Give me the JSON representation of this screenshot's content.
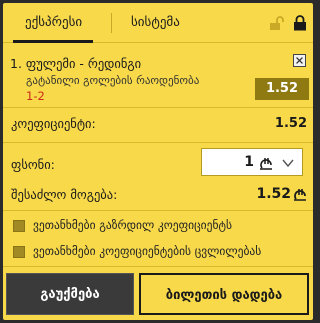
{
  "tabs": [
    {
      "label": "ექსპრესი",
      "active": true
    },
    {
      "label": "სისტემა",
      "active": false
    }
  ],
  "icons": {
    "unlock": "lock-open-icon",
    "lock": "lock-icon",
    "remove": "close-icon",
    "currency": "lari-icon",
    "dropdown": "chevron-down-icon"
  },
  "bet": {
    "index": "1.",
    "match": "ფულემი - რედინგი",
    "market": "გატანილი გოლების რაოდენობა",
    "pick": "1-2",
    "odds": "1.52"
  },
  "summary": {
    "coef_label": "კოეფიციენტი:",
    "coef_value": "1.52",
    "stake_label": "ფსონი:",
    "stake_value": "1",
    "win_label": "შესაძლო მოგება:",
    "win_value": "1.52"
  },
  "options": [
    {
      "label": "ვეთანხმები გაზრდილ კოეფიციენტს",
      "checked": false
    },
    {
      "label": "ვეთანხმები კოეფიციენტების ცვლილებას",
      "checked": false
    }
  ],
  "buttons": {
    "cancel": "გაუქმება",
    "place": "ბილეთის დადება"
  },
  "colors": {
    "panel": "#f7d94a",
    "odds_bg": "#8f7a12",
    "pick": "#cc2a1a",
    "frame": "#2b2b2b"
  }
}
